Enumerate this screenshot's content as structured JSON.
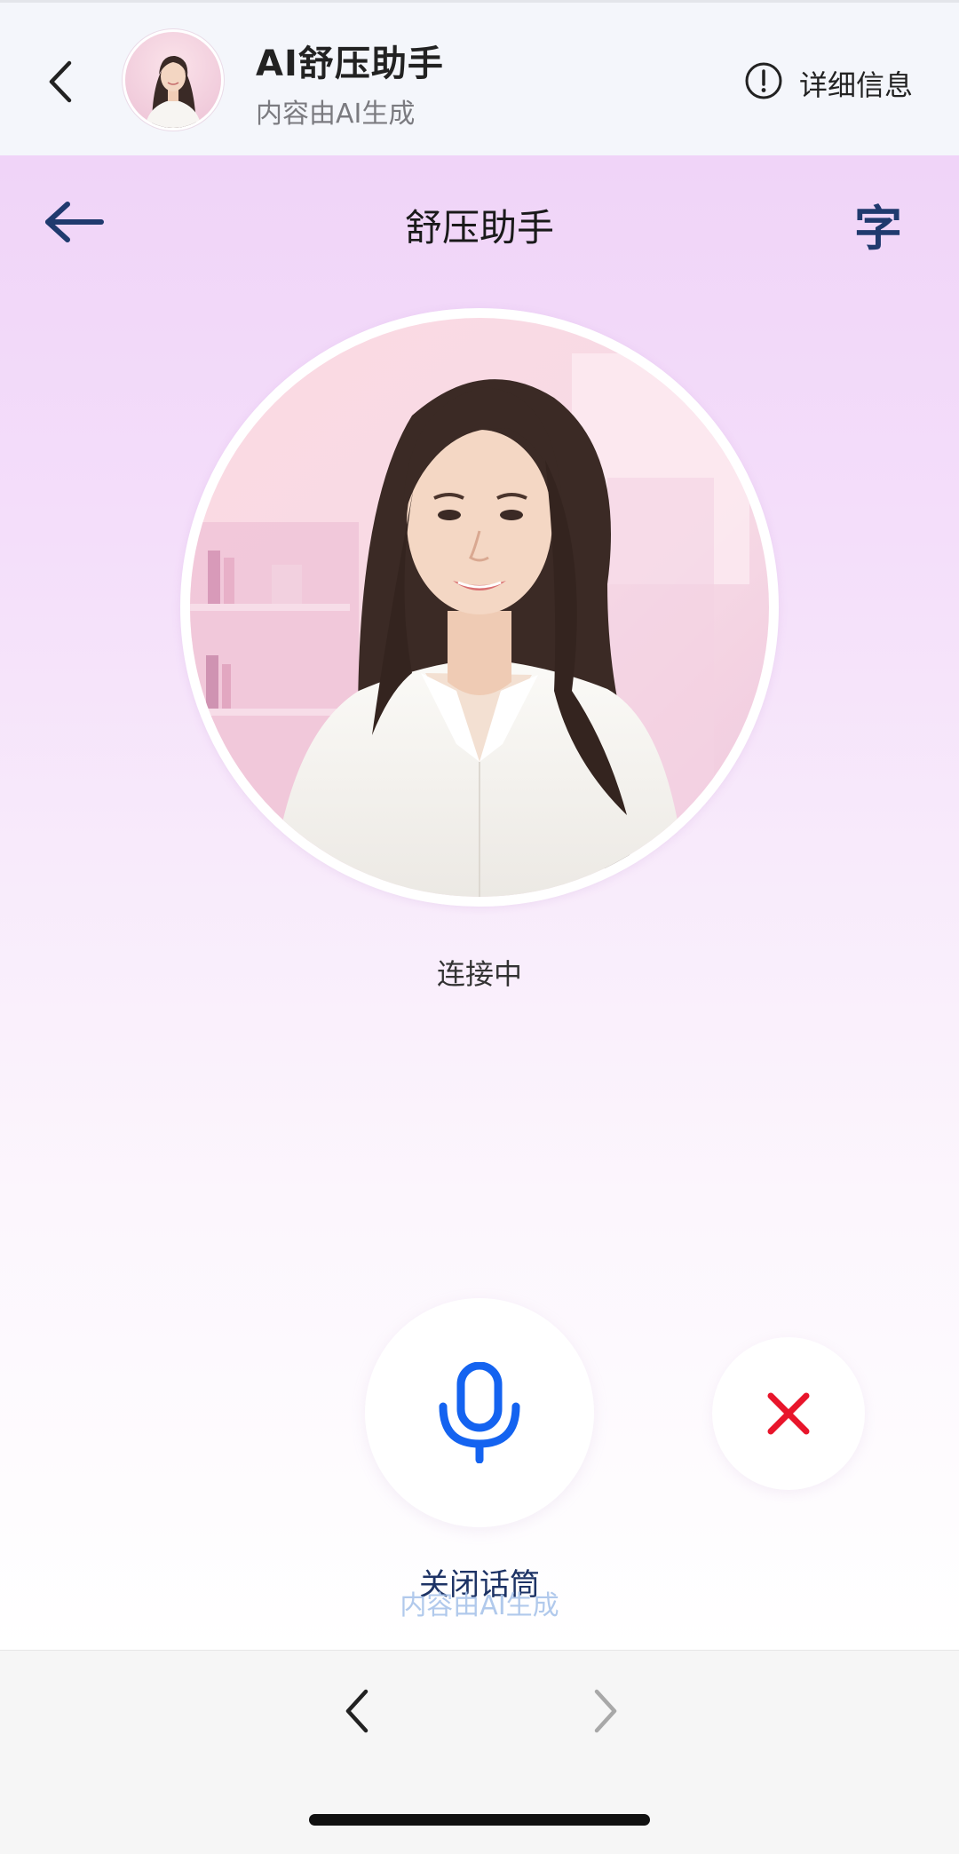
{
  "header": {
    "back_icon": "chevron-left-icon",
    "title": "AI舒压助手",
    "subtitle": "内容由AI生成",
    "info_icon": "exclamation-circle-icon",
    "info_label": "详细信息"
  },
  "call": {
    "back_icon": "arrow-left-icon",
    "title": "舒压助手",
    "caption_toggle": "字",
    "status": "连接中",
    "mic_icon": "microphone-icon",
    "mic_label": "关闭话筒",
    "hangup_icon": "close-x-icon",
    "watermark": "内容由AI生成"
  },
  "bottom_bar": {
    "back_icon": "chevron-left-icon",
    "forward_icon": "chevron-right-icon"
  },
  "colors": {
    "accent_blue": "#1463f0",
    "hangup_red": "#e8152b",
    "dark_navy": "#203a6e",
    "background_lavender": "#f0d4f8"
  }
}
